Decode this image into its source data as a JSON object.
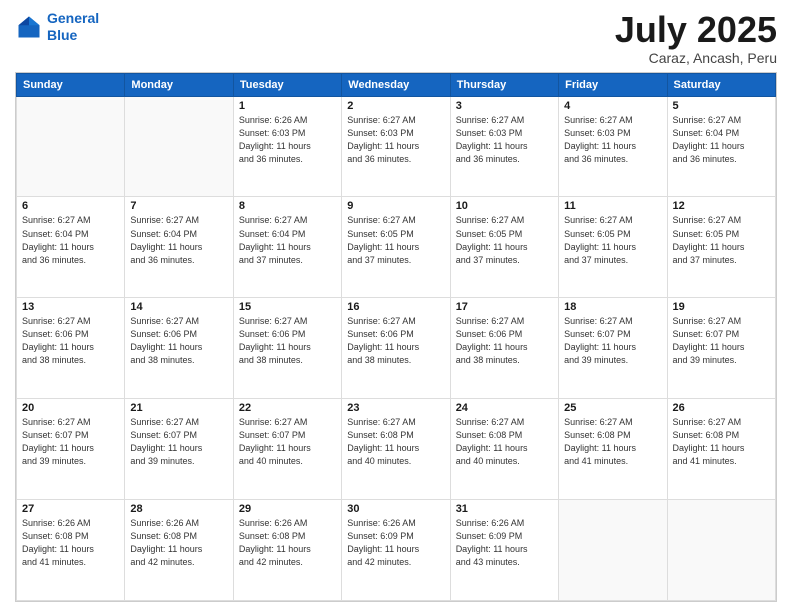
{
  "header": {
    "logo_line1": "General",
    "logo_line2": "Blue",
    "title": "July 2025",
    "subtitle": "Caraz, Ancash, Peru"
  },
  "calendar": {
    "days_of_week": [
      "Sunday",
      "Monday",
      "Tuesday",
      "Wednesday",
      "Thursday",
      "Friday",
      "Saturday"
    ],
    "weeks": [
      [
        {
          "day": "",
          "info": ""
        },
        {
          "day": "",
          "info": ""
        },
        {
          "day": "1",
          "info": "Sunrise: 6:26 AM\nSunset: 6:03 PM\nDaylight: 11 hours\nand 36 minutes."
        },
        {
          "day": "2",
          "info": "Sunrise: 6:27 AM\nSunset: 6:03 PM\nDaylight: 11 hours\nand 36 minutes."
        },
        {
          "day": "3",
          "info": "Sunrise: 6:27 AM\nSunset: 6:03 PM\nDaylight: 11 hours\nand 36 minutes."
        },
        {
          "day": "4",
          "info": "Sunrise: 6:27 AM\nSunset: 6:03 PM\nDaylight: 11 hours\nand 36 minutes."
        },
        {
          "day": "5",
          "info": "Sunrise: 6:27 AM\nSunset: 6:04 PM\nDaylight: 11 hours\nand 36 minutes."
        }
      ],
      [
        {
          "day": "6",
          "info": "Sunrise: 6:27 AM\nSunset: 6:04 PM\nDaylight: 11 hours\nand 36 minutes."
        },
        {
          "day": "7",
          "info": "Sunrise: 6:27 AM\nSunset: 6:04 PM\nDaylight: 11 hours\nand 36 minutes."
        },
        {
          "day": "8",
          "info": "Sunrise: 6:27 AM\nSunset: 6:04 PM\nDaylight: 11 hours\nand 37 minutes."
        },
        {
          "day": "9",
          "info": "Sunrise: 6:27 AM\nSunset: 6:05 PM\nDaylight: 11 hours\nand 37 minutes."
        },
        {
          "day": "10",
          "info": "Sunrise: 6:27 AM\nSunset: 6:05 PM\nDaylight: 11 hours\nand 37 minutes."
        },
        {
          "day": "11",
          "info": "Sunrise: 6:27 AM\nSunset: 6:05 PM\nDaylight: 11 hours\nand 37 minutes."
        },
        {
          "day": "12",
          "info": "Sunrise: 6:27 AM\nSunset: 6:05 PM\nDaylight: 11 hours\nand 37 minutes."
        }
      ],
      [
        {
          "day": "13",
          "info": "Sunrise: 6:27 AM\nSunset: 6:06 PM\nDaylight: 11 hours\nand 38 minutes."
        },
        {
          "day": "14",
          "info": "Sunrise: 6:27 AM\nSunset: 6:06 PM\nDaylight: 11 hours\nand 38 minutes."
        },
        {
          "day": "15",
          "info": "Sunrise: 6:27 AM\nSunset: 6:06 PM\nDaylight: 11 hours\nand 38 minutes."
        },
        {
          "day": "16",
          "info": "Sunrise: 6:27 AM\nSunset: 6:06 PM\nDaylight: 11 hours\nand 38 minutes."
        },
        {
          "day": "17",
          "info": "Sunrise: 6:27 AM\nSunset: 6:06 PM\nDaylight: 11 hours\nand 38 minutes."
        },
        {
          "day": "18",
          "info": "Sunrise: 6:27 AM\nSunset: 6:07 PM\nDaylight: 11 hours\nand 39 minutes."
        },
        {
          "day": "19",
          "info": "Sunrise: 6:27 AM\nSunset: 6:07 PM\nDaylight: 11 hours\nand 39 minutes."
        }
      ],
      [
        {
          "day": "20",
          "info": "Sunrise: 6:27 AM\nSunset: 6:07 PM\nDaylight: 11 hours\nand 39 minutes."
        },
        {
          "day": "21",
          "info": "Sunrise: 6:27 AM\nSunset: 6:07 PM\nDaylight: 11 hours\nand 39 minutes."
        },
        {
          "day": "22",
          "info": "Sunrise: 6:27 AM\nSunset: 6:07 PM\nDaylight: 11 hours\nand 40 minutes."
        },
        {
          "day": "23",
          "info": "Sunrise: 6:27 AM\nSunset: 6:08 PM\nDaylight: 11 hours\nand 40 minutes."
        },
        {
          "day": "24",
          "info": "Sunrise: 6:27 AM\nSunset: 6:08 PM\nDaylight: 11 hours\nand 40 minutes."
        },
        {
          "day": "25",
          "info": "Sunrise: 6:27 AM\nSunset: 6:08 PM\nDaylight: 11 hours\nand 41 minutes."
        },
        {
          "day": "26",
          "info": "Sunrise: 6:27 AM\nSunset: 6:08 PM\nDaylight: 11 hours\nand 41 minutes."
        }
      ],
      [
        {
          "day": "27",
          "info": "Sunrise: 6:26 AM\nSunset: 6:08 PM\nDaylight: 11 hours\nand 41 minutes."
        },
        {
          "day": "28",
          "info": "Sunrise: 6:26 AM\nSunset: 6:08 PM\nDaylight: 11 hours\nand 42 minutes."
        },
        {
          "day": "29",
          "info": "Sunrise: 6:26 AM\nSunset: 6:08 PM\nDaylight: 11 hours\nand 42 minutes."
        },
        {
          "day": "30",
          "info": "Sunrise: 6:26 AM\nSunset: 6:09 PM\nDaylight: 11 hours\nand 42 minutes."
        },
        {
          "day": "31",
          "info": "Sunrise: 6:26 AM\nSunset: 6:09 PM\nDaylight: 11 hours\nand 43 minutes."
        },
        {
          "day": "",
          "info": ""
        },
        {
          "day": "",
          "info": ""
        }
      ]
    ]
  }
}
